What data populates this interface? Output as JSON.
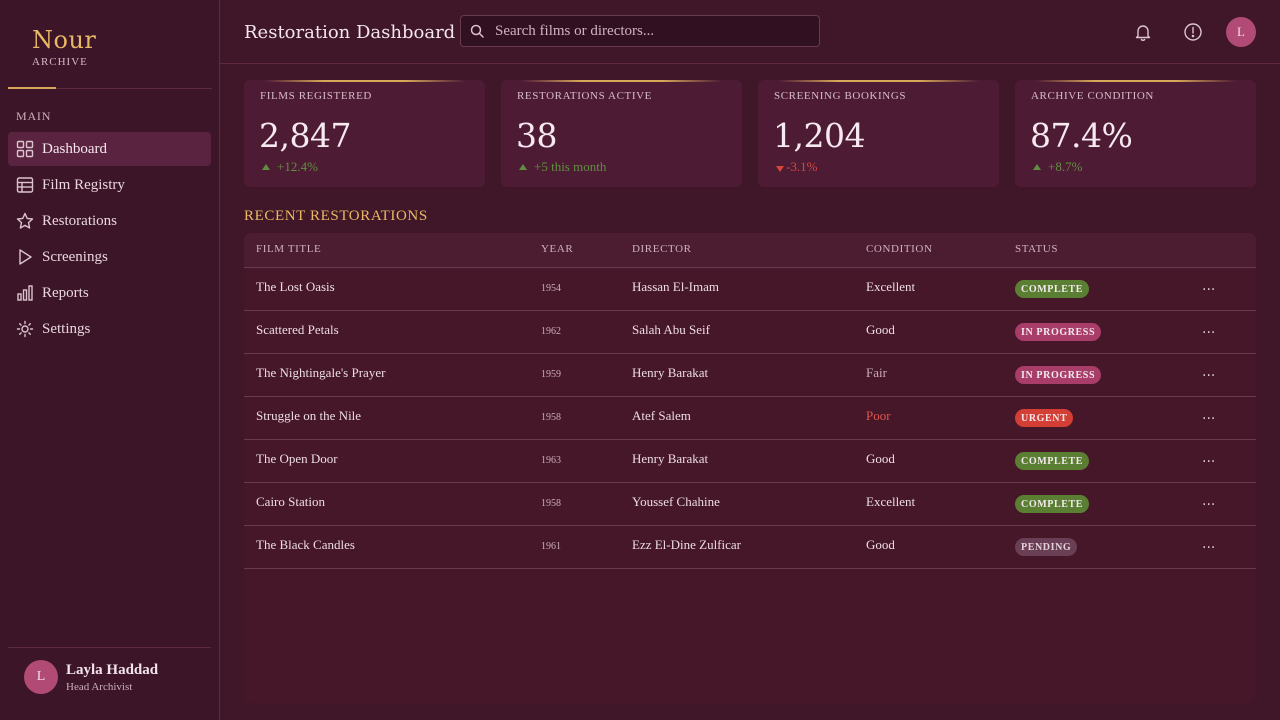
{
  "brand": {
    "name": "Nour",
    "subtitle": "ARCHIVE"
  },
  "sidebar": {
    "section_label": "MAIN",
    "items": [
      {
        "label": "Dashboard",
        "icon": "grid-icon",
        "active": true
      },
      {
        "label": "Film Registry",
        "icon": "table-icon",
        "active": false
      },
      {
        "label": "Restorations",
        "icon": "star-icon",
        "active": false
      },
      {
        "label": "Screenings",
        "icon": "play-icon",
        "active": false
      },
      {
        "label": "Reports",
        "icon": "bar-chart-icon",
        "active": false
      },
      {
        "label": "Settings",
        "icon": "sun-gear-icon",
        "active": false
      }
    ],
    "user": {
      "initial": "L",
      "name": "Layla Haddad",
      "role": "Head Archivist"
    }
  },
  "header": {
    "title": "Restoration Dashboard",
    "search_placeholder": "Search films or directors...",
    "avatar_initial": "L"
  },
  "stats": [
    {
      "label": "FILMS REGISTERED",
      "value": "2,847",
      "trend": "+12.4%",
      "direction": "up"
    },
    {
      "label": "RESTORATIONS ACTIVE",
      "value": "38",
      "trend": "+5 this month",
      "direction": "up"
    },
    {
      "label": "SCREENING BOOKINGS",
      "value": "1,204",
      "trend": "-3.1%",
      "direction": "down"
    },
    {
      "label": "ARCHIVE CONDITION",
      "value": "87.4%",
      "trend": "+8.7%",
      "direction": "up"
    }
  ],
  "table": {
    "title": "RECENT RESTORATIONS",
    "columns": [
      "FILM TITLE",
      "YEAR",
      "DIRECTOR",
      "CONDITION",
      "STATUS"
    ],
    "more_label": "...",
    "rows": [
      {
        "title": "The Lost Oasis",
        "year": "1954",
        "director": "Hassan El-Imam",
        "condition": "Excellent",
        "status": "COMPLETE",
        "status_type": "complete"
      },
      {
        "title": "Scattered Petals",
        "year": "1962",
        "director": "Salah Abu Seif",
        "condition": "Good",
        "status": "IN PROGRESS",
        "status_type": "progress"
      },
      {
        "title": "The Nightingale's Prayer",
        "year": "1959",
        "director": "Henry Barakat",
        "condition": "Fair",
        "status": "IN PROGRESS",
        "status_type": "progress"
      },
      {
        "title": "Struggle on the Nile",
        "year": "1958",
        "director": "Atef Salem",
        "condition": "Poor",
        "status": "URGENT",
        "status_type": "urgent"
      },
      {
        "title": "The Open Door",
        "year": "1963",
        "director": "Henry Barakat",
        "condition": "Good",
        "status": "COMPLETE",
        "status_type": "complete"
      },
      {
        "title": "Cairo Station",
        "year": "1958",
        "director": "Youssef Chahine",
        "condition": "Excellent",
        "status": "COMPLETE",
        "status_type": "complete"
      },
      {
        "title": "The Black Candles",
        "year": "1961",
        "director": "Ezz El-Dine Zulficar",
        "condition": "Good",
        "status": "PENDING",
        "status_type": "pending"
      }
    ]
  },
  "colors": {
    "background": "#3f1729",
    "accent_gold": "#e9b864",
    "status_complete": "#5a7f33",
    "status_progress": "#a83d6a",
    "status_urgent": "#d33f34",
    "status_pending": "#6a3e55"
  }
}
